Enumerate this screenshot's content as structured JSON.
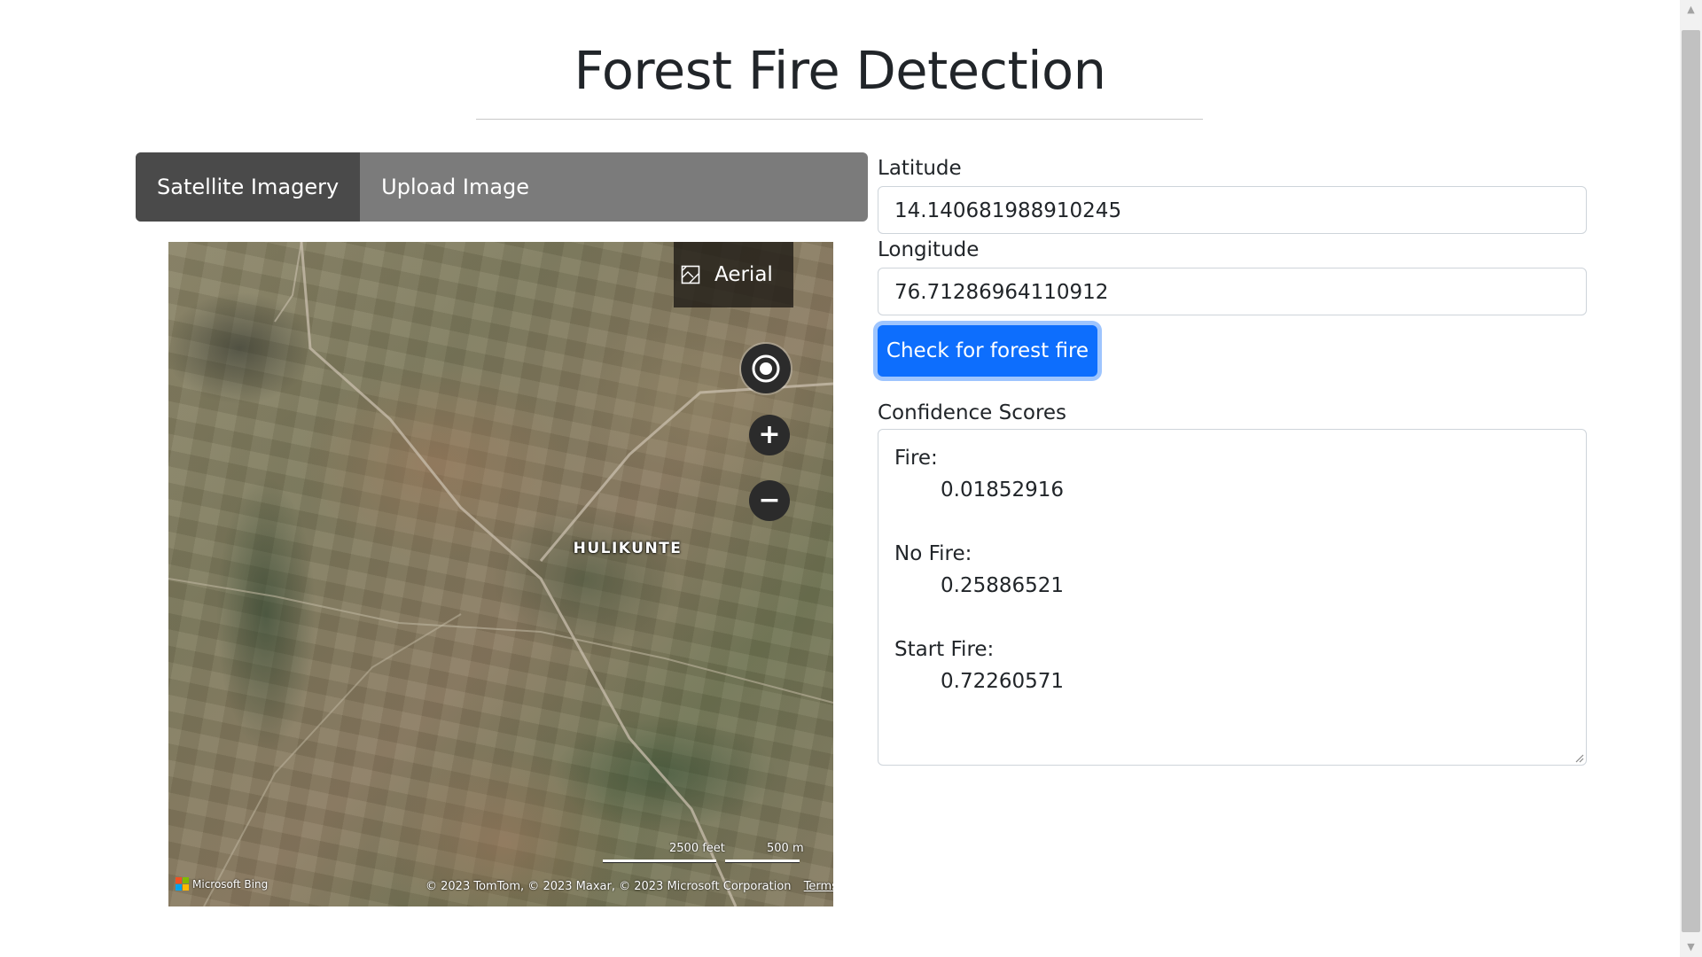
{
  "page": {
    "title": "Forest Fire Detection"
  },
  "tabs": [
    {
      "label": "Satellite Imagery",
      "active": true
    },
    {
      "label": "Upload Image",
      "active": false
    }
  ],
  "map": {
    "place_label": "HULIKUNTE",
    "view_button_label": "Aerial",
    "view_button_icon": "aerial-view-icon",
    "locate_icon": "locate-me-icon",
    "zoom_in_icon": "plus-icon",
    "zoom_out_icon": "minus-icon",
    "zoom_in_glyph": "+",
    "zoom_out_glyph": "−",
    "scale_feet": "2500 feet",
    "scale_meters": "500 m",
    "provider_logo": "Microsoft Bing",
    "copyright": "© 2023 TomTom, © 2023 Maxar, © 2023 Microsoft Corporation",
    "terms_link": "Terms"
  },
  "form": {
    "latitude_label": "Latitude",
    "latitude_value": "14.140681988910245",
    "longitude_label": "Longitude",
    "longitude_value": "76.71286964110912",
    "submit_label": "Check for forest fire",
    "scores_label": "Confidence Scores",
    "scores": [
      {
        "label": "Fire:",
        "value": "0.01852916"
      },
      {
        "label": "No Fire:",
        "value": "0.25886521"
      },
      {
        "label": "Start Fire:",
        "value": "0.72260571"
      }
    ]
  },
  "colors": {
    "primary_button": "#0d6efd",
    "tab_bar": "#7b7b7b",
    "tab_active": "#4a4a4a",
    "map_control": "#2b2b2b"
  }
}
